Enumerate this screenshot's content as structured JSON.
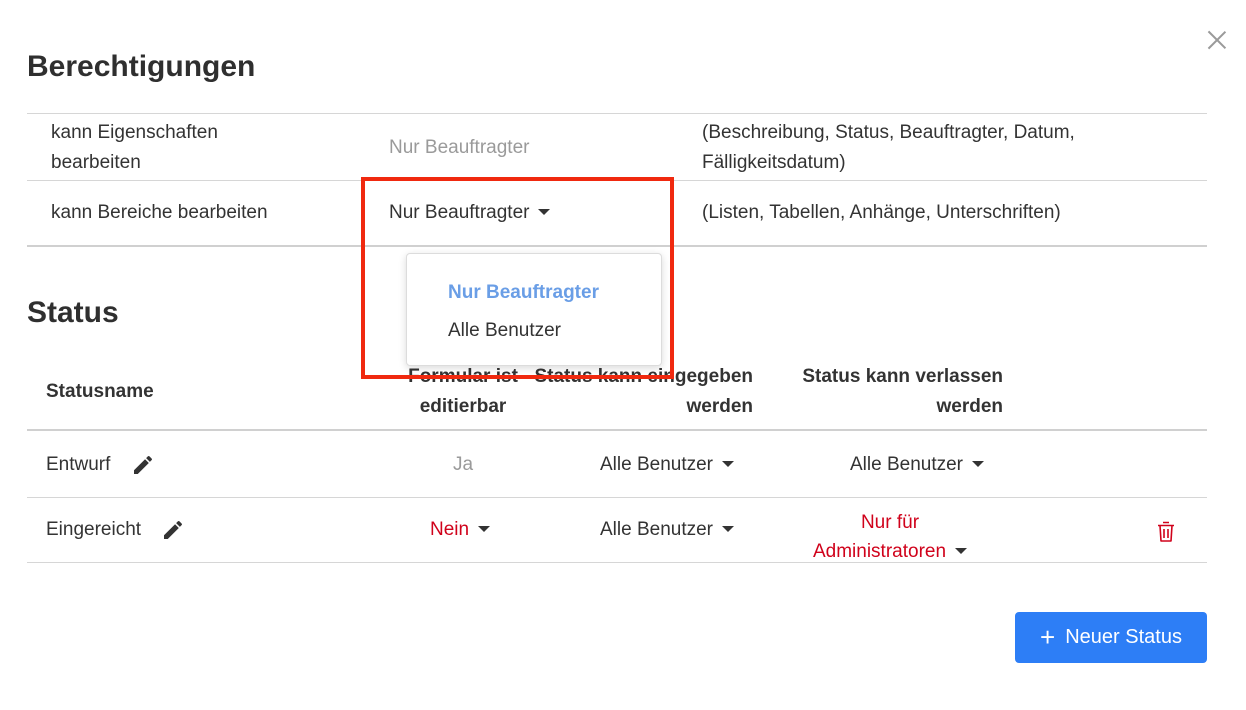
{
  "dialog": {
    "permissions_title": "Berechtigungen",
    "status_title": "Status",
    "close_icon": "close-icon"
  },
  "permissions": [
    {
      "label": "kann Eigenschaften bearbeiten",
      "label_line1": "kann Eigenschaften",
      "label_line2": "bearbeiten",
      "value": "Nur Beauftragter",
      "note_line1": "(Beschreibung, Status, Beauftragter, Datum,",
      "note_line2": "Fälligkeitsdatum)"
    },
    {
      "label": "kann Bereiche bearbeiten",
      "value": "Nur Beauftragter",
      "note": "(Listen, Tabellen, Anhänge, Unterschriften)"
    }
  ],
  "dropdown_menu": {
    "options": [
      "Nur Beauftragter",
      "Alle Benutzer"
    ],
    "selected": "Nur Beauftragter"
  },
  "status_table": {
    "headers": {
      "name": "Statusname",
      "editable_line1": "Formular ist",
      "editable_line2": "editierbar",
      "enter_line1": "Status kann eingegeben",
      "enter_line2": "werden",
      "leave_line1": "Status kann verlassen",
      "leave_line2": "werden"
    },
    "rows": [
      {
        "name": "Entwurf",
        "editable": "Ja",
        "enter": "Alle Benutzer",
        "leave": "Alle Benutzer"
      },
      {
        "name": "Eingereicht",
        "editable": "Nein",
        "enter": "Alle Benutzer",
        "leave_line1": "Nur für",
        "leave_line2": "Administratoren"
      }
    ]
  },
  "actions": {
    "new_status": "Neuer Status"
  },
  "colors": {
    "accent": "#2d7ef6",
    "danger": "#d0021b",
    "highlight": "#f0290f",
    "menu_active": "#6a9ee6"
  }
}
